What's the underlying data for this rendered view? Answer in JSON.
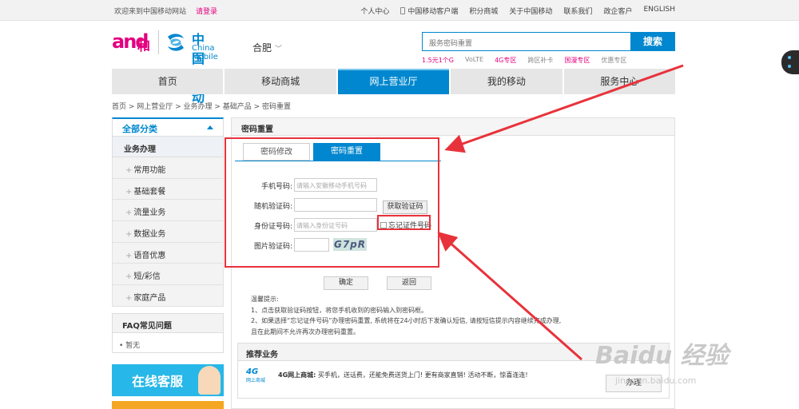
{
  "topbar": {
    "welcome": "欢迎来到中国移动网站",
    "login": "请登录",
    "links": [
      "个人中心",
      "中国移动客户端",
      "积分商城",
      "关于中国移动",
      "联系我们",
      "政企客户",
      "ENGLISH"
    ]
  },
  "brand": {
    "and_text": "and",
    "he_text": "和",
    "cm_cn": "中国移动",
    "cm_en": "China Mobile",
    "city": "合肥",
    "pink": "#e4007f",
    "blue": "#0087cf"
  },
  "search": {
    "placeholder": "服务密码重置",
    "button": "搜索",
    "hotwords": [
      "1.5元1个G",
      "VoLTE",
      "4G专区",
      "跨区补卡",
      "国漫专区",
      "优惠专区"
    ]
  },
  "nav": {
    "items": [
      "首页",
      "移动商城",
      "网上营业厅",
      "我的移动",
      "服务中心"
    ],
    "active_index": 2
  },
  "breadcrumb": "首页 > 网上营业厅 > 业务办理 > 基础产品 > 密码重置",
  "sidebar": {
    "head": "全部分类",
    "sub": "业务办理",
    "items": [
      "常用功能",
      "基础套餐",
      "流量业务",
      "数据业务",
      "语音优惠",
      "短/彩信",
      "家庭产品"
    ],
    "faq_title": "FAQ常见问题",
    "faq_none": "暂无",
    "service_banner": "在线客服"
  },
  "main": {
    "title": "密码重置",
    "tabs": [
      "密码修改",
      "密码重置"
    ],
    "form": {
      "phone_label": "手机号码:",
      "phone_placeholder": "请输入安徽移动手机号码",
      "sms_label": "随机验证码:",
      "sms_button": "获取验证码",
      "id_label": "身份证号码:",
      "id_placeholder": "请输入身份证号码",
      "forgot_id": "忘记证件号码",
      "captcha_label": "图片验证码:",
      "captcha_text": "G7pR"
    },
    "ok": "确定",
    "back": "返回",
    "tips": [
      "温馨提示:",
      "1、点击获取验证码按钮，将您手机收到的密码输入到密码框。",
      "2、如果选择“忘记证件号码”办理密码重置, 系统将在24小时后下发确认短信, 请按短信提示内容继续完成办理,",
      "且在此期间不允许再次办理密码重置。"
    ],
    "rec": {
      "title": "推荐业务",
      "logo_4g": "4G",
      "logo_text": "网上商城",
      "item_name": "4G网上商城:",
      "item_desc": "买手机，送话费，还能免费送货上门! 更有商家直销! 活动不断，惊喜连连!",
      "button": "办理"
    }
  },
  "watermark": {
    "brand": "Baidu 经验",
    "url": "jingyan.baidu.com"
  },
  "annotation_color": "#e8323b"
}
